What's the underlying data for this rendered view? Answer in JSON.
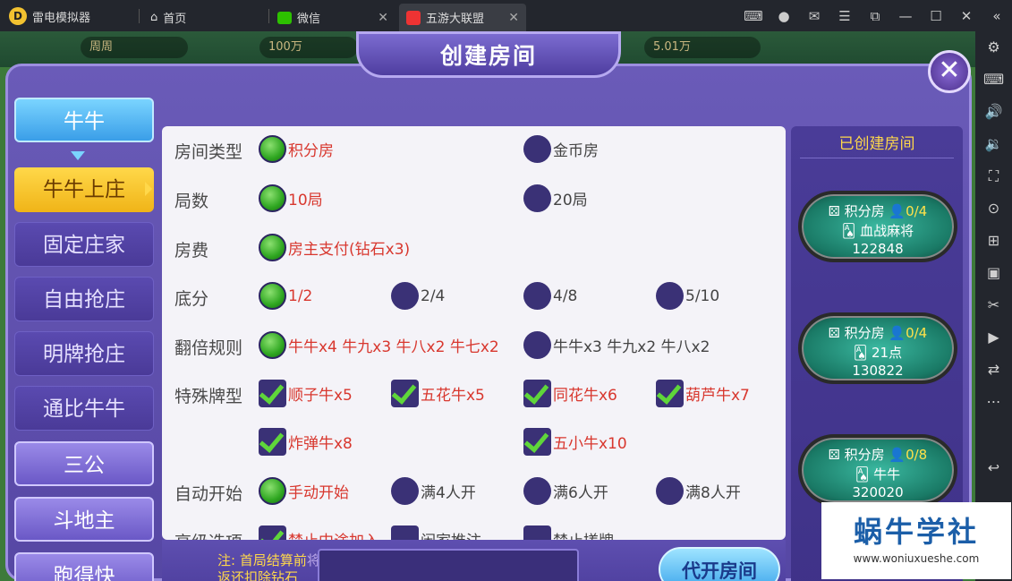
{
  "titlebar": {
    "app_name": "雷电模拟器",
    "tabs": [
      {
        "label": "首页"
      },
      {
        "label": "微信"
      },
      {
        "label": "五游大联盟"
      }
    ]
  },
  "topbar": {
    "name": "周周",
    "gold": "100万",
    "diamond": "5.01万"
  },
  "dialog": {
    "title": "创建房间",
    "nav": [
      {
        "label": "牛牛"
      },
      {
        "label": "牛牛上庄"
      },
      {
        "label": "固定庄家"
      },
      {
        "label": "自由抢庄"
      },
      {
        "label": "明牌抢庄"
      },
      {
        "label": "通比牛牛"
      },
      {
        "label": "三公"
      },
      {
        "label": "斗地主"
      },
      {
        "label": "跑得快"
      }
    ],
    "rows": [
      {
        "label": "房间类型",
        "options": [
          "积分房",
          "金币房"
        ]
      },
      {
        "label": "局数",
        "options": [
          "10局",
          "20局"
        ]
      },
      {
        "label": "房费",
        "options": [
          "房主支付(钻石x3)"
        ]
      },
      {
        "label": "底分",
        "options": [
          "1/2",
          "2/4",
          "4/8",
          "5/10"
        ]
      },
      {
        "label": "翻倍规则",
        "options": [
          "牛牛x4 牛九x3 牛八x2 牛七x2",
          "牛牛x3 牛九x2 牛八x2"
        ]
      },
      {
        "label": "特殊牌型",
        "options": [
          "顺子牛x5",
          "五花牛x5",
          "同花牛x6",
          "葫芦牛x7",
          "炸弹牛x8",
          "五小牛x10"
        ]
      },
      {
        "label": "自动开始",
        "options": [
          "手动开始",
          "满4人开",
          "满6人开",
          "满8人开"
        ]
      },
      {
        "label": "高级选项",
        "options": [
          "禁止中途加入",
          "闲家推注",
          "禁止搓牌"
        ]
      }
    ],
    "note_line1": "注: 首局结算前",
    "note_line1_tail": "将",
    "note_line2": "返还扣除钻石",
    "create_button": "代开房间",
    "created_header": "已创建房间",
    "rooms": [
      {
        "type": "积分房",
        "count": "0/4",
        "game": "血战麻将",
        "id": "122848"
      },
      {
        "type": "积分房",
        "count": "0/4",
        "game": "21点",
        "id": "130822"
      },
      {
        "type": "积分房",
        "count": "0/8",
        "game": "牛牛",
        "id": "320020"
      }
    ]
  },
  "watermark": {
    "title": "蜗牛学社",
    "url": "www.woniuxueshe.com"
  }
}
